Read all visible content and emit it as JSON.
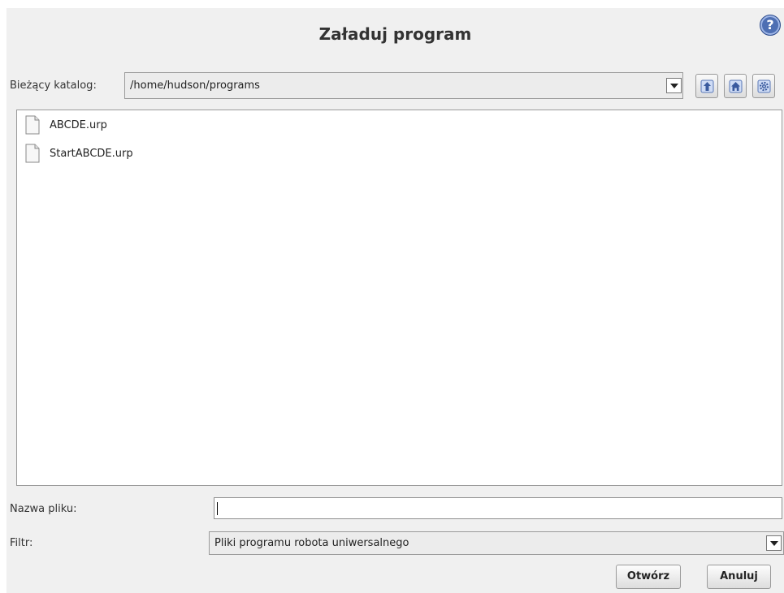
{
  "dialog": {
    "title": "Załaduj program",
    "help_icon": "question-icon"
  },
  "directory": {
    "label": "Bieżący katalog:",
    "current_path": "/home/hudson/programs",
    "buttons": [
      {
        "name": "up-directory",
        "icon": "arrow-up-icon"
      },
      {
        "name": "home-directory",
        "icon": "home-icon"
      },
      {
        "name": "settings",
        "icon": "gear-icon"
      }
    ]
  },
  "files": [
    {
      "name": "ABCDE.urp",
      "icon": "file-icon"
    },
    {
      "name": "StartABCDE.urp",
      "icon": "file-icon"
    }
  ],
  "filename": {
    "label": "Nazwa pliku:",
    "value": ""
  },
  "filter": {
    "label": "Filtr:",
    "selected": "Pliki programu robota uniwersalnego"
  },
  "actions": {
    "open_label": "Otwórz",
    "cancel_label": "Anuluj"
  },
  "colors": {
    "accent": "#4e6fb3",
    "background": "#f0f0f0"
  }
}
